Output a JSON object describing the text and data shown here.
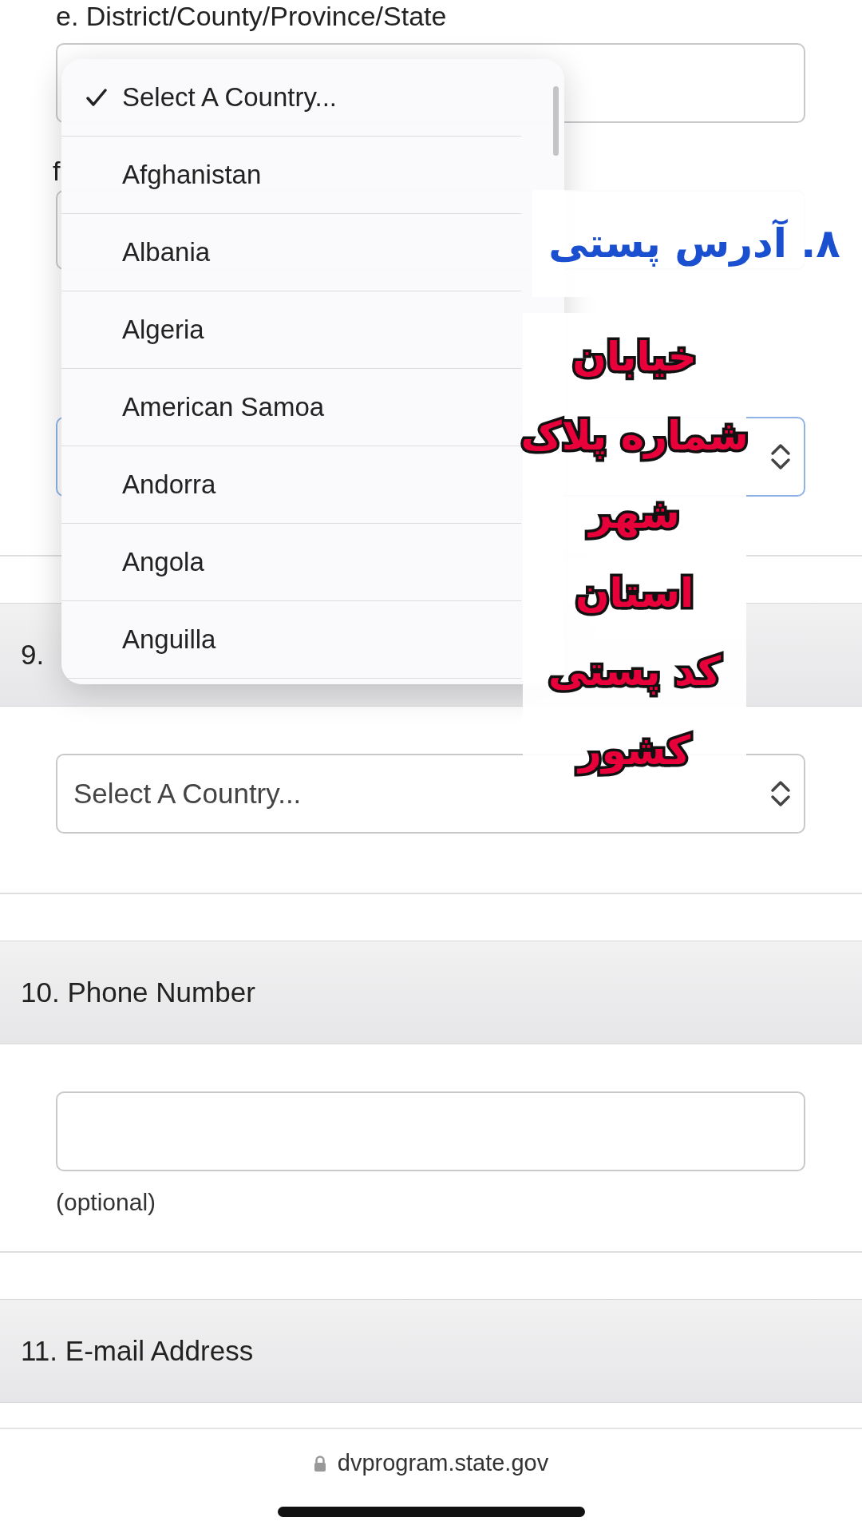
{
  "top_fields": [
    {
      "label": "e. District/County/Province/State",
      "kind": "text",
      "focused": false
    },
    {
      "label": "f",
      "kind": "text",
      "focused": false
    },
    {
      "kind": "select",
      "focused": true
    }
  ],
  "sections": [
    {
      "heading": "9.",
      "kind": "select",
      "value": "Select A Country..."
    },
    {
      "heading": "10. Phone Number",
      "kind": "text",
      "note": "(optional)"
    },
    {
      "heading": "11. E-mail Address"
    }
  ],
  "dropdown": {
    "options": [
      {
        "label": "Select A Country...",
        "selected": true
      },
      {
        "label": "Afghanistan",
        "selected": false
      },
      {
        "label": "Albania",
        "selected": false
      },
      {
        "label": "Algeria",
        "selected": false
      },
      {
        "label": "American Samoa",
        "selected": false
      },
      {
        "label": "Andorra",
        "selected": false
      },
      {
        "label": "Angola",
        "selected": false
      },
      {
        "label": "Anguilla",
        "selected": false
      }
    ]
  },
  "caption": {
    "title": "۸. آدرس پستی",
    "lines": [
      "خیابان",
      "شماره پلاک",
      "شهر",
      "استان",
      "کد پستی",
      "کشور"
    ]
  },
  "browser_bar": {
    "url": "dvprogram.state.gov"
  }
}
